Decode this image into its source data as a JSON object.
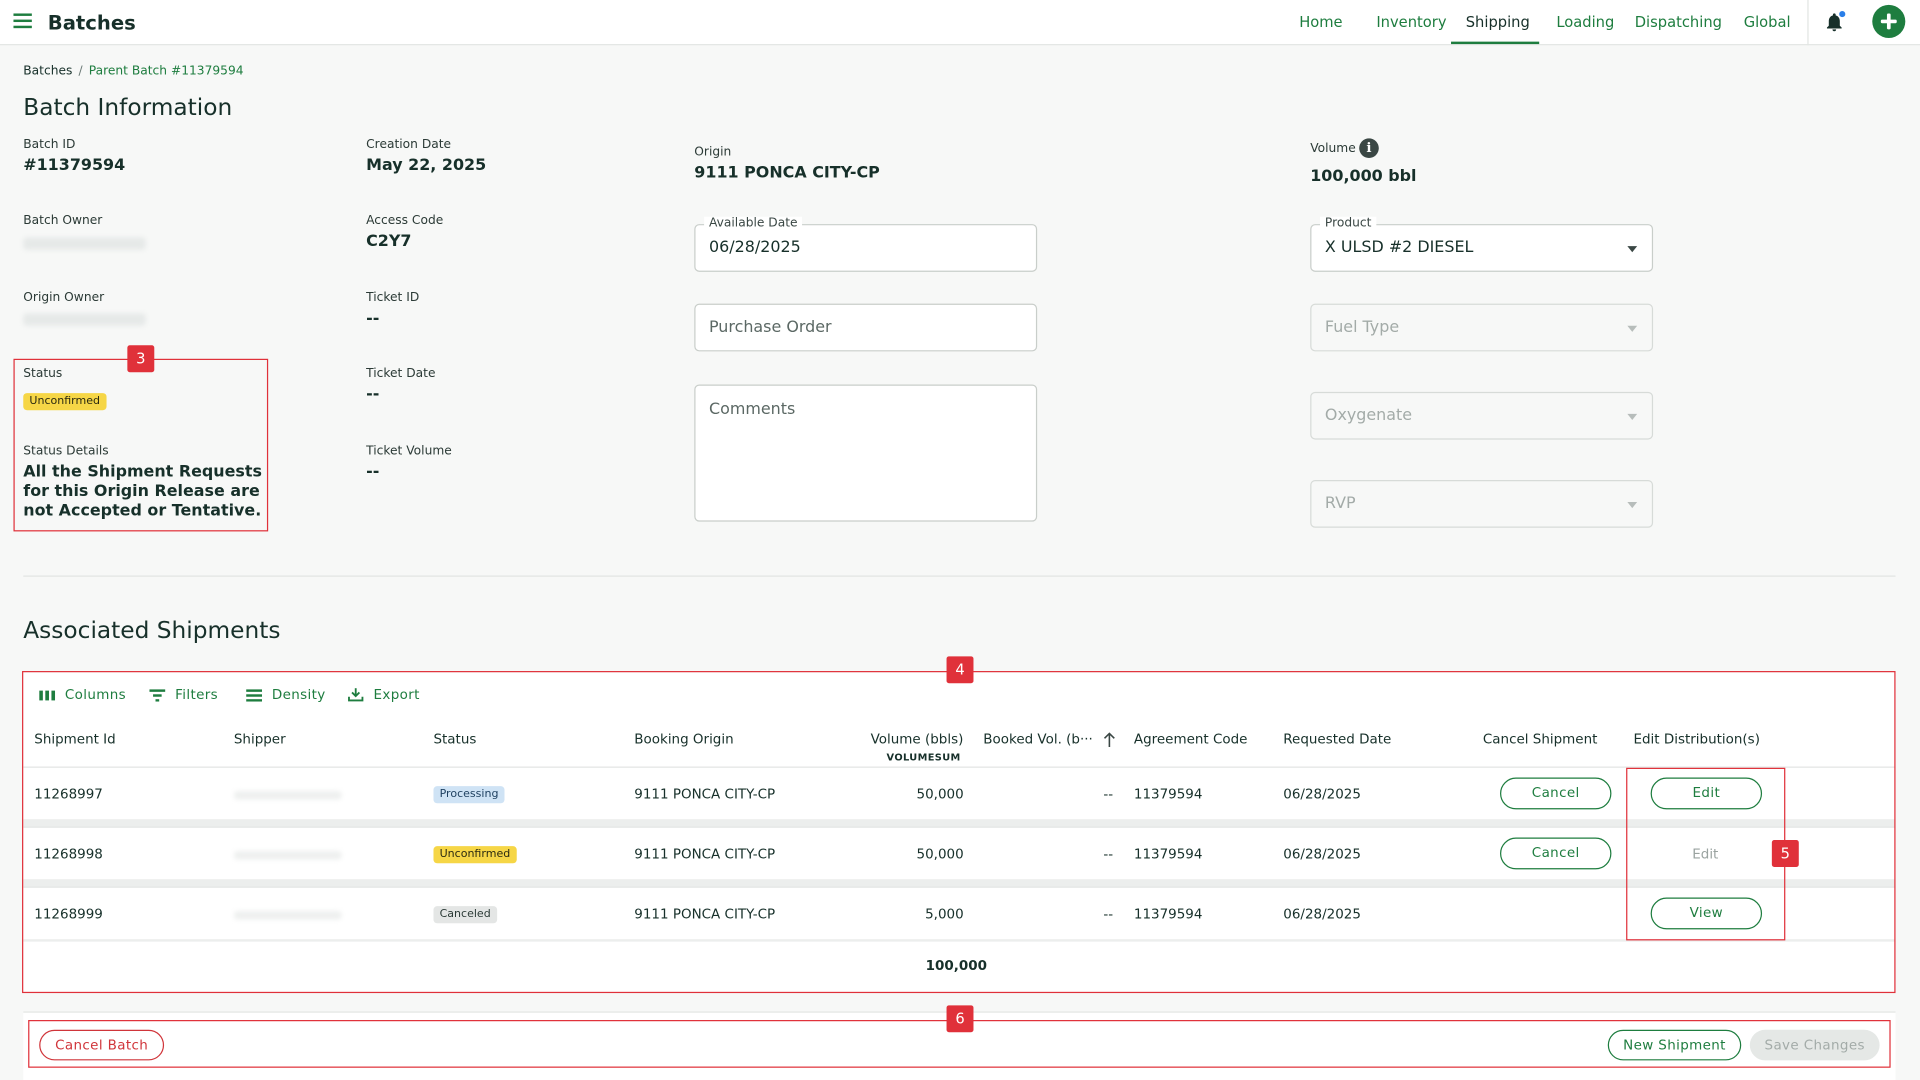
{
  "header": {
    "app_title": "Batches",
    "nav": [
      "Home",
      "Inventory",
      "Shipping",
      "Loading",
      "Dispatching",
      "Global"
    ],
    "active_nav": "Shipping"
  },
  "breadcrumb": {
    "root": "Batches",
    "separator": "/",
    "current": "Parent Batch #11379594"
  },
  "page_title": "Batch Information",
  "batch": {
    "batch_id_label": "Batch ID",
    "batch_id": "#11379594",
    "creation_date_label": "Creation Date",
    "creation_date": "May 22, 2025",
    "origin_label": "Origin",
    "origin": "9111 PONCA CITY-CP",
    "volume_label": "Volume",
    "volume": "100,000 bbl",
    "batch_owner_label": "Batch Owner",
    "access_code_label": "Access Code",
    "access_code": "C2Y7",
    "origin_owner_label": "Origin Owner",
    "ticket_id_label": "Ticket ID",
    "ticket_id": "--",
    "status_label": "Status",
    "status": "Unconfirmed",
    "ticket_date_label": "Ticket Date",
    "ticket_date": "--",
    "status_details_label": "Status Details",
    "status_details": "All the Shipment Requests for this Origin Release are not Accepted or Tentative.",
    "ticket_volume_label": "Ticket Volume",
    "ticket_volume": "--"
  },
  "form": {
    "available_date_label": "Available Date",
    "available_date": "06/28/2025",
    "purchase_order_placeholder": "Purchase Order",
    "comments_placeholder": "Comments",
    "product_label": "Product",
    "product": "X ULSD #2 DIESEL",
    "fuel_type_placeholder": "Fuel Type",
    "oxygenate_placeholder": "Oxygenate",
    "rvp_placeholder": "RVP"
  },
  "shipments": {
    "title": "Associated Shipments",
    "toolbar": [
      "Columns",
      "Filters",
      "Density",
      "Export"
    ],
    "columns": [
      "Shipment Id",
      "Shipper",
      "Status",
      "Booking Origin",
      "Volume (bbls)",
      "Booked Vol. (b···",
      "Agreement Code",
      "Requested Date",
      "Cancel Shipment",
      "Edit Distribution(s)"
    ],
    "volume_sum_label": "VOLUMESUM",
    "rows": [
      {
        "id": "11268997",
        "status": "Processing",
        "origin": "9111 PONCA CITY-CP",
        "volume": "50,000",
        "booked": "--",
        "agreement": "11379594",
        "requested": "06/28/2025",
        "cancel": "Cancel",
        "edit": "Edit"
      },
      {
        "id": "11268998",
        "status": "Unconfirmed",
        "origin": "9111 PONCA CITY-CP",
        "volume": "50,000",
        "booked": "--",
        "agreement": "11379594",
        "requested": "06/28/2025",
        "cancel": "Cancel",
        "edit": "Edit"
      },
      {
        "id": "11268999",
        "status": "Canceled",
        "origin": "9111 PONCA CITY-CP",
        "volume": "5,000",
        "booked": "--",
        "agreement": "11379594",
        "requested": "06/28/2025",
        "cancel": "",
        "edit": "View"
      }
    ],
    "total_volume": "100,000"
  },
  "footer": {
    "cancel_batch": "Cancel Batch",
    "new_shipment": "New Shipment",
    "save_changes": "Save Changes"
  },
  "annotations": [
    "3",
    "4",
    "5",
    "6"
  ],
  "colors": {
    "accent": "#1e7d3f",
    "annotation": "#e0313a",
    "warning_badge": "#f6d646"
  }
}
